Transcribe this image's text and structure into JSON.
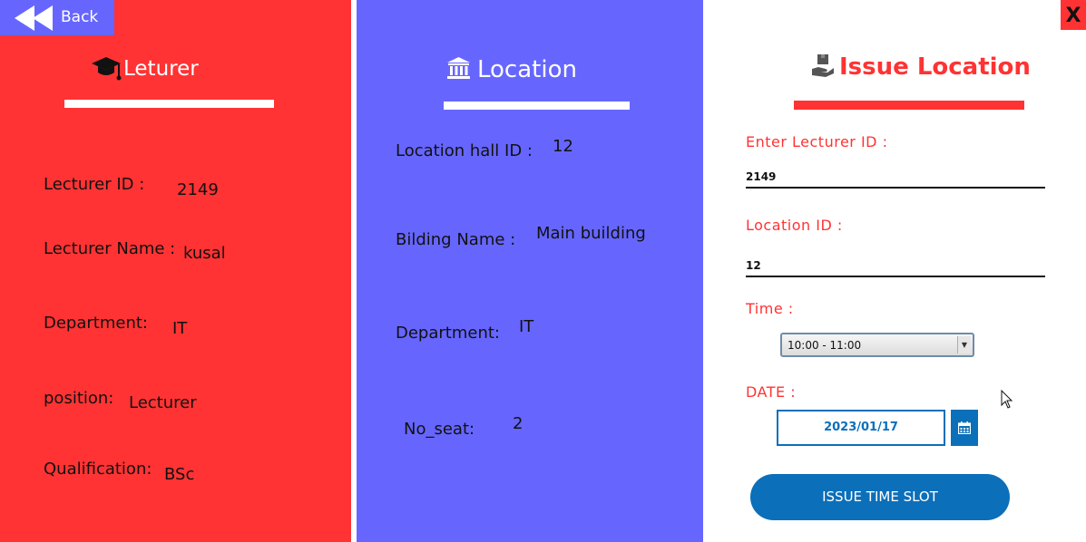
{
  "back": {
    "label": "Back"
  },
  "close": {
    "label": "X"
  },
  "lecturer": {
    "title": "Leturer",
    "fields": [
      {
        "label": "Lecturer ID :",
        "value": "2149"
      },
      {
        "label": "Lecturer Name :",
        "value": "kusal"
      },
      {
        "label": "Department:",
        "value": "IT"
      },
      {
        "label": "position:",
        "value": "Lecturer"
      },
      {
        "label": "Qualification:",
        "value": "BSc"
      }
    ]
  },
  "location": {
    "title": "Location",
    "fields": [
      {
        "label": "Location hall ID :",
        "value": "12"
      },
      {
        "label": "Bilding Name :",
        "value": "Main building"
      },
      {
        "label": "Department:",
        "value": "IT"
      },
      {
        "label": "No_seat:",
        "value": "2"
      }
    ]
  },
  "issue": {
    "title": "Issue Location",
    "lecturer_id_label": "Enter Lecturer ID :",
    "lecturer_id_value": "2149",
    "location_id_label": "Location ID :",
    "location_id_value": "12",
    "time_label": "Time :",
    "time_value": "10:00 - 11:00",
    "date_label": "DATE :",
    "date_value": "2023/01/17",
    "submit_label": "ISSUE  TIME SLOT"
  },
  "colors": {
    "red": "#ff3333",
    "blue_panel": "#6666ff",
    "accent_blue": "#0b6fba"
  },
  "icons": {
    "back": "double-left-arrow-icon",
    "lecturer": "graduation-cap-icon",
    "location": "bank-building-icon",
    "issue": "hand-holding-box-icon",
    "calendar": "calendar-icon",
    "cursor": "mouse-pointer-icon"
  }
}
